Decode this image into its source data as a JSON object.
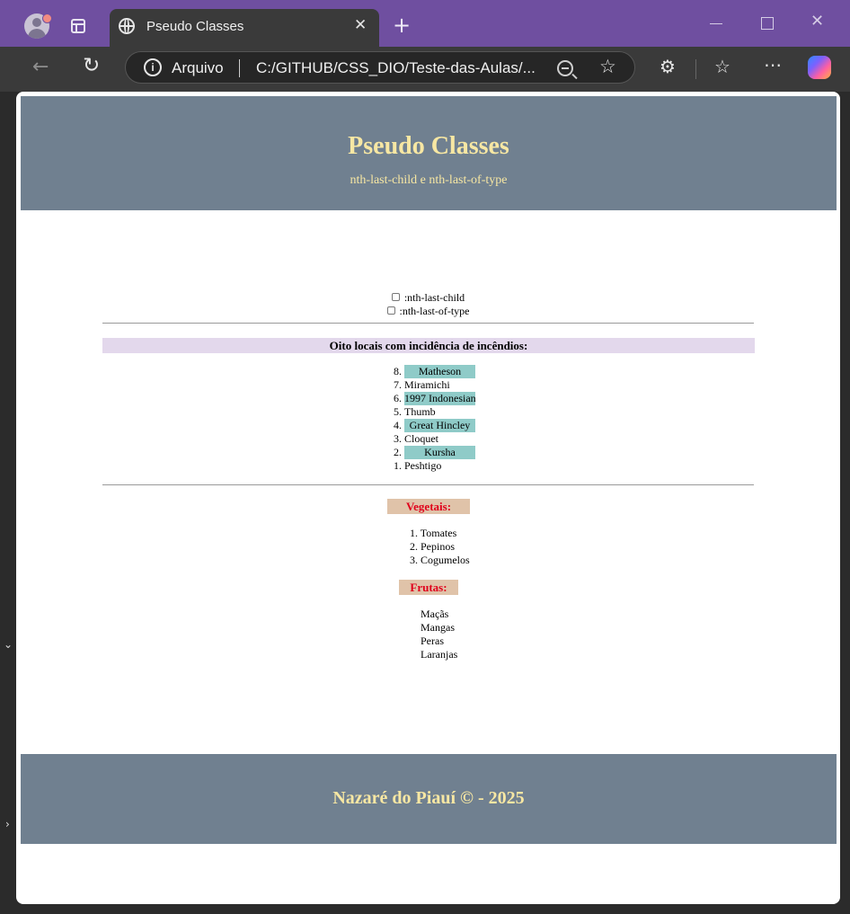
{
  "browser": {
    "tab_title": "Pseudo Classes",
    "tab_close": "✕",
    "new_tab": "+",
    "address_label": "Arquivo",
    "address_url": "C:/GITHUB/CSS_DIO/Teste-das-Aulas/...",
    "info_glyph": "i",
    "icons": {
      "back": "arrow-left-icon",
      "reload": "reload-icon",
      "zoom": "zoom-out-icon",
      "favorite": "star-icon",
      "extensions": "puzzle-icon",
      "favorites": "favorites-list-icon",
      "more": "more-icon",
      "copilot": "copilot-icon"
    },
    "accent_color": "#6f4fa0"
  },
  "page": {
    "header": {
      "title": "Pseudo Classes",
      "subtitle": "nth-last-child e nth-last-of-type"
    },
    "controls": [
      {
        "label": ":nth-last-child",
        "checked": false
      },
      {
        "label": ":nth-last-of-type",
        "checked": false
      }
    ],
    "fires_section": {
      "title": "Oito locais com incidência de incêndios:",
      "items": [
        {
          "num": "8.",
          "name": "Matheson",
          "highlighted": true
        },
        {
          "num": "7.",
          "name": "Miramichi",
          "highlighted": false
        },
        {
          "num": "6.",
          "name": "1997 Indonesian",
          "highlighted": true
        },
        {
          "num": "5.",
          "name": "Thumb",
          "highlighted": false
        },
        {
          "num": "4.",
          "name": "Great Hincley",
          "highlighted": true
        },
        {
          "num": "3.",
          "name": "Cloquet",
          "highlighted": false
        },
        {
          "num": "2.",
          "name": "Kursha",
          "highlighted": true
        },
        {
          "num": "1.",
          "name": "Peshtigo",
          "highlighted": false
        }
      ]
    },
    "vegetables": {
      "title": "Vegetais:",
      "items": [
        "1. Tomates",
        "2. Pepinos",
        "3. Cogumelos"
      ]
    },
    "fruits": {
      "title": "Frutas:",
      "items": [
        "Maçãs",
        "Mangas",
        "Peras",
        "Laranjas"
      ]
    },
    "footer": {
      "text": "Nazaré do Piauí © - 2025"
    },
    "colors": {
      "header_bg": "#708090",
      "header_text": "#f7e7a3",
      "section_bg": "#e3d8ec",
      "highlight_bg": "#8fcbc8",
      "list_title_bg": "#e0c3a9",
      "list_title_text": "#e0001b"
    }
  }
}
